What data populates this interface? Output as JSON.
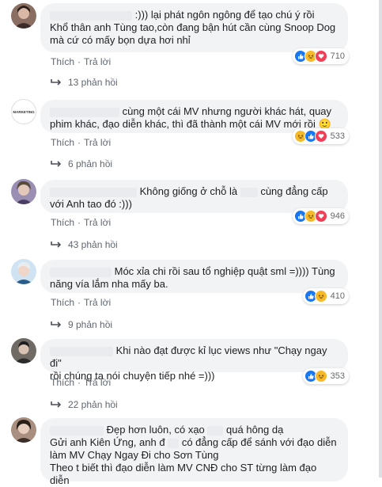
{
  "actions": {
    "like": "Thích",
    "reply": "Trả lời",
    "dot": "·"
  },
  "comments": [
    {
      "text_1": ":))) lại phát ngôn ngông để tạo chú ý rồi",
      "text_2": "Khổ thân anh Tùng tao,còn đang bận hút cần cùng Snoop Dog",
      "text_3": "mà cứ có mấy bọn dựa hơi nhỉ",
      "reaction_count": "710",
      "replies": "13 phản hồi"
    },
    {
      "avatar_text": "MARKETING",
      "text_1": "cùng một cái MV nhưng người khác hát, quay",
      "text_2": "phim khác, đạo diễn khác, thì đã thành một cái MV mới rồi",
      "emoji": "🙂",
      "reaction_count": "533",
      "replies": "6 phản hồi"
    },
    {
      "text_1a": "Không giống ở chỗ là",
      "text_1b": "cùng đẳng cấp",
      "text_2": "với Anh tao đó :)))",
      "reaction_count": "946",
      "replies": "43 phản hồi"
    },
    {
      "text_1": "Móc xỉa chi rồi sau tổ nghiệp quật sml =)))) Tùng",
      "text_2": "năng vía lắm nha mấy ba.",
      "reaction_count": "410",
      "replies": "9 phản hồi"
    },
    {
      "text_1": "Khi nào đạt được kỉ lục views như \"Chạy ngay đi\"",
      "text_2": "rồi chúng ta nói chuyện tiếp nhé =)))",
      "reaction_count": "353",
      "replies": "22 phản hồi"
    },
    {
      "text_1a": "Đẹp hơn luôn, có xạo",
      "text_1b": "quá hông dạ",
      "text_2a": "Gửi anh Kiên Ứng, anh đ",
      "text_2b": "có đẳng cấp để sánh với đạo diễn",
      "text_3": "làm MV Chạy Ngay Đi cho Sơn Tùng",
      "text_4": "Theo t biết thì đạo diễn làm MV CNĐ cho ST từng làm đạo diễn"
    }
  ],
  "colors": {
    "like": "#1877f2",
    "haha": "#f7b928",
    "love": "#f33e58",
    "bubble": "#f2f3f5"
  }
}
